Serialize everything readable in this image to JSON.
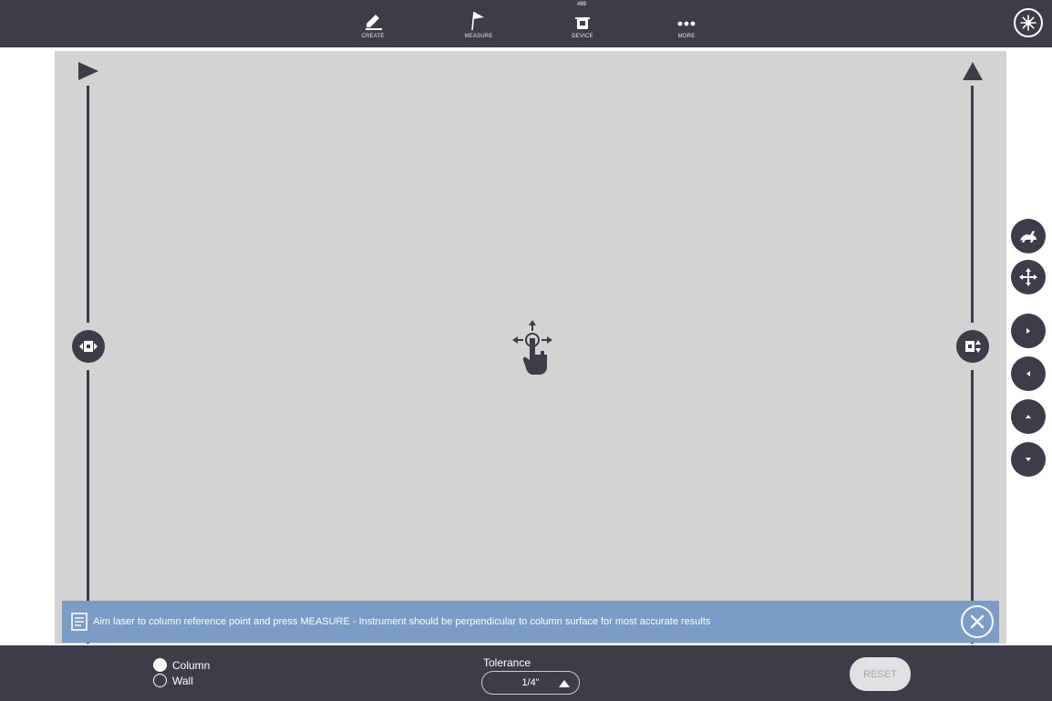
{
  "topbar": {
    "nav": [
      {
        "label": "CREATE",
        "icon": "pencil-icon"
      },
      {
        "label": "MEASURE",
        "icon": "flag-icon"
      },
      {
        "label": "DEVICE",
        "icon": "instrument-icon",
        "badge": "#89"
      },
      {
        "label": "MORE",
        "icon": "more-dots-icon"
      }
    ],
    "laser_icon": "laser-star-icon"
  },
  "side_controls": [
    "rabbit-speed-icon",
    "move-arrows-icon",
    "arrow-right-icon",
    "arrow-left-icon",
    "arrow-up-icon",
    "arrow-down-icon"
  ],
  "banner": {
    "message": "Aim laser to column reference point and press MEASURE - Instrument should be perpendicular to column surface for most accurate results"
  },
  "bottom": {
    "options": [
      {
        "label": "Column",
        "selected": true
      },
      {
        "label": "Wall",
        "selected": false
      }
    ],
    "tolerance_label": "Tolerance",
    "tolerance_value": "1/4\"",
    "reset_label": "RESET"
  },
  "colors": {
    "bar": "#3c3d48",
    "viewport": "#d3d3d3",
    "banner": "#7a9cc6"
  }
}
